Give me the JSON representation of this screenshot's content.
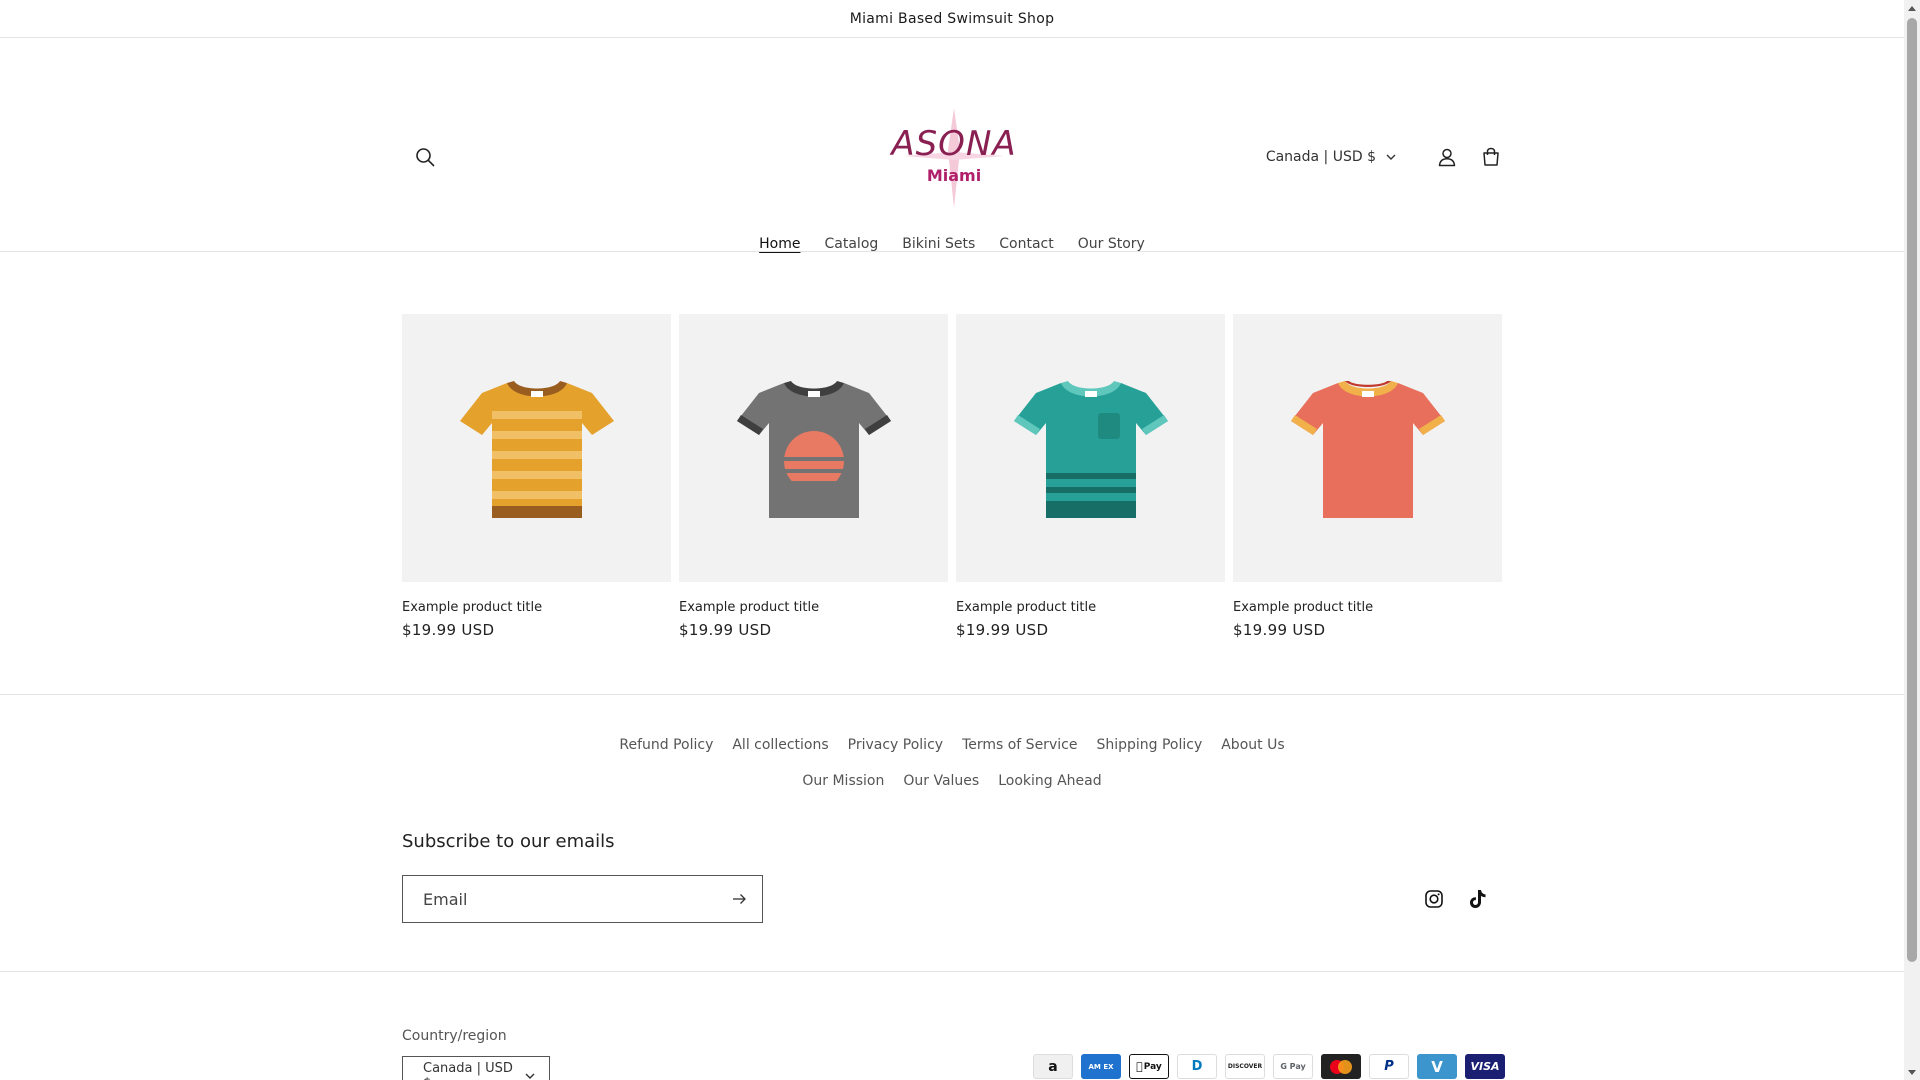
{
  "announcement": "Miami Based Swimsuit Shop",
  "logo": {
    "name": "ASONA",
    "subtitle": "Miami",
    "color": "#8a1f52"
  },
  "header": {
    "country_label": "Canada | USD $",
    "icons": [
      "search-icon",
      "account-icon",
      "cart-icon",
      "chevron-down-icon"
    ]
  },
  "nav": {
    "items": [
      "Home",
      "Catalog",
      "Bikini Sets",
      "Contact",
      "Our Story"
    ],
    "active": "Home"
  },
  "products": [
    {
      "title": "Example product title",
      "price": "$19.99 USD",
      "color": "#e4a12b"
    },
    {
      "title": "Example product title",
      "price": "$19.99 USD",
      "color": "#737373"
    },
    {
      "title": "Example product title",
      "price": "$19.99 USD",
      "color": "#27a197"
    },
    {
      "title": "Example product title",
      "price": "$19.99 USD",
      "color": "#e76f5c"
    }
  ],
  "footer": {
    "links": [
      "Refund Policy",
      "All collections",
      "Privacy Policy",
      "Terms of Service",
      "Shipping Policy",
      "About Us",
      "Our Mission",
      "Our Values",
      "Looking Ahead"
    ],
    "subscribe_title": "Subscribe to our emails",
    "email_placeholder": "Email",
    "socials": [
      "instagram-icon",
      "tiktok-icon"
    ],
    "country_region_label": "Country/region",
    "country_value": "Canada | USD $",
    "payments": [
      {
        "name": "amazon-pay-icon",
        "label": "a"
      },
      {
        "name": "american-express-icon",
        "label": "AM EX"
      },
      {
        "name": "apple-pay-icon",
        "label": "Pay"
      },
      {
        "name": "diners-club-icon",
        "label": "D"
      },
      {
        "name": "discover-icon",
        "label": "DISCOVER"
      },
      {
        "name": "google-pay-icon",
        "label": "G Pay"
      },
      {
        "name": "mastercard-icon",
        "label": ""
      },
      {
        "name": "paypal-icon",
        "label": "P"
      },
      {
        "name": "venmo-icon",
        "label": "V"
      },
      {
        "name": "visa-icon",
        "label": "VISA"
      }
    ]
  }
}
